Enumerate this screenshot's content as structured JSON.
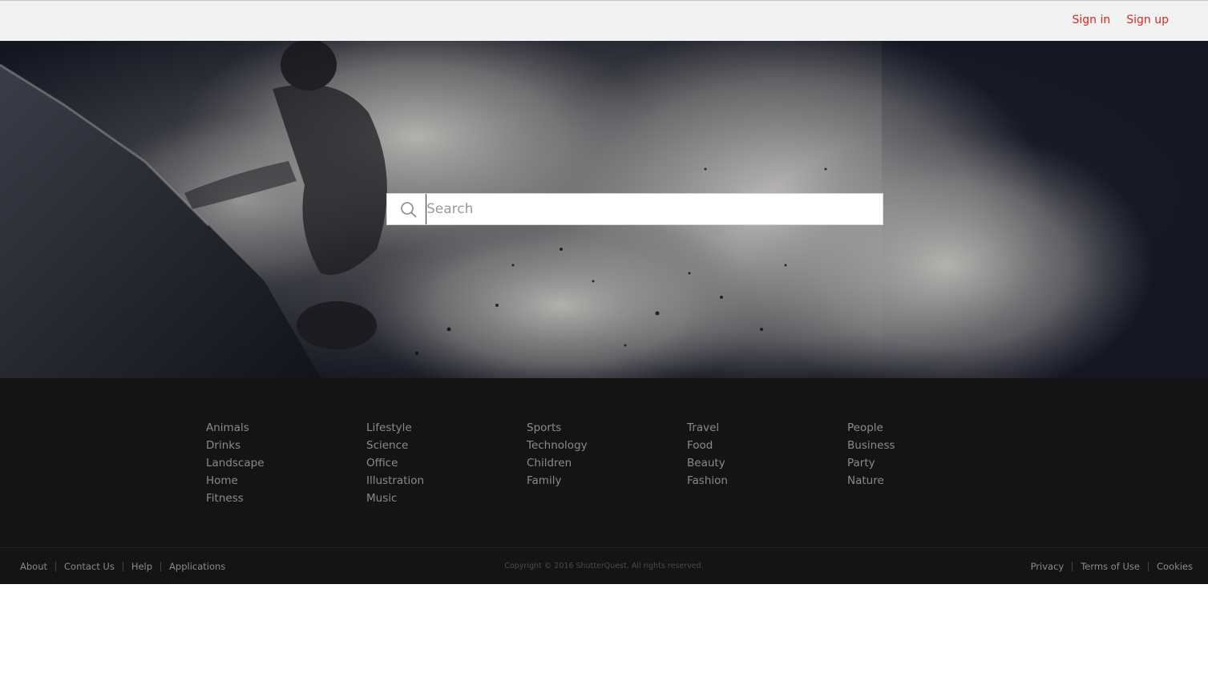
{
  "header": {
    "sign_in": "Sign in",
    "sign_up": "Sign up",
    "link_color": "#d9281f"
  },
  "hero": {
    "search_placeholder": "Search",
    "search_icon": "search-icon"
  },
  "categories": [
    [
      "Animals",
      "Drinks",
      "Landscape",
      "Home",
      "Fitness"
    ],
    [
      "Lifestyle",
      "Science",
      "Office",
      "Illustration",
      "Music"
    ],
    [
      "Sports",
      "Technology",
      "Children",
      "Family"
    ],
    [
      "Travel",
      "Food",
      "Beauty",
      "Fashion"
    ],
    [
      "People",
      "Business",
      "Party",
      "Nature"
    ]
  ],
  "footer": {
    "left_links": [
      "About",
      "Contact Us",
      "Help",
      "Applications"
    ],
    "copyright": "Copyright © 2016 ShutterQuest. All rights reserved.",
    "right_links": [
      "Privacy",
      "Terms of Use",
      "Cookies"
    ]
  }
}
